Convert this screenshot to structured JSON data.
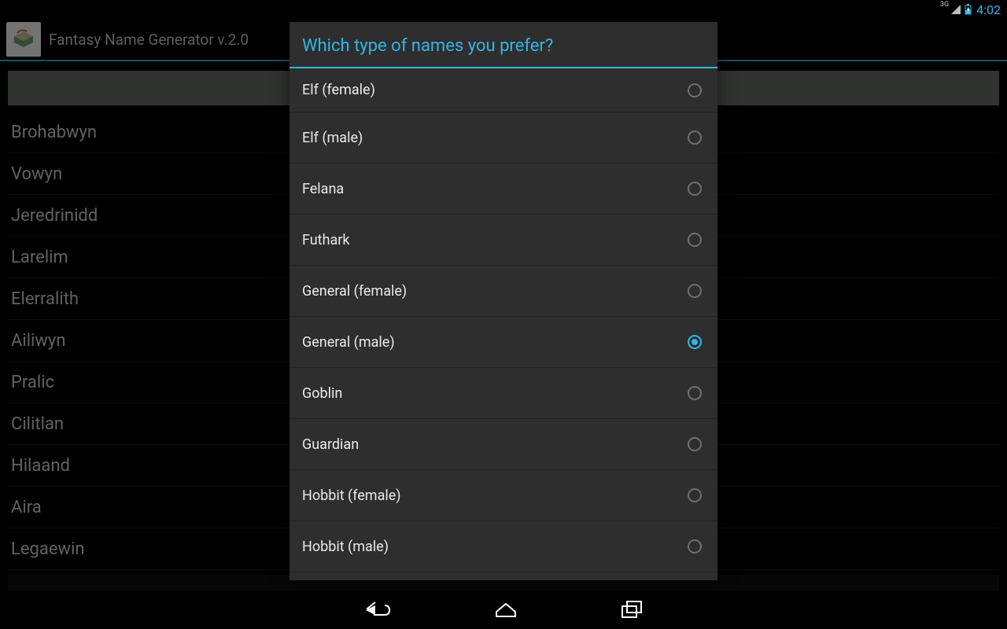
{
  "status_bar": {
    "network_type": "3G",
    "clock": "4:02",
    "accent": "#33b5e5"
  },
  "action_bar": {
    "title": "Fantasy Name Generator v.2.0"
  },
  "name_list": [
    "Brohabwyn",
    "Vowyn",
    "Jeredrinidd",
    "Larelim",
    "Elerralith",
    "Ailiwyn",
    "Pralic",
    "Cilitlan",
    "Hilaand",
    "Aira",
    "Legaewin"
  ],
  "dialog": {
    "title": "Which type of names you prefer?",
    "selected_index": 5,
    "options": [
      "Elf (female)",
      "Elf (male)",
      "Felana",
      "Futhark",
      "General (female)",
      "General (male)",
      "Goblin",
      "Guardian",
      "Hobbit (female)",
      "Hobbit (male)"
    ]
  }
}
